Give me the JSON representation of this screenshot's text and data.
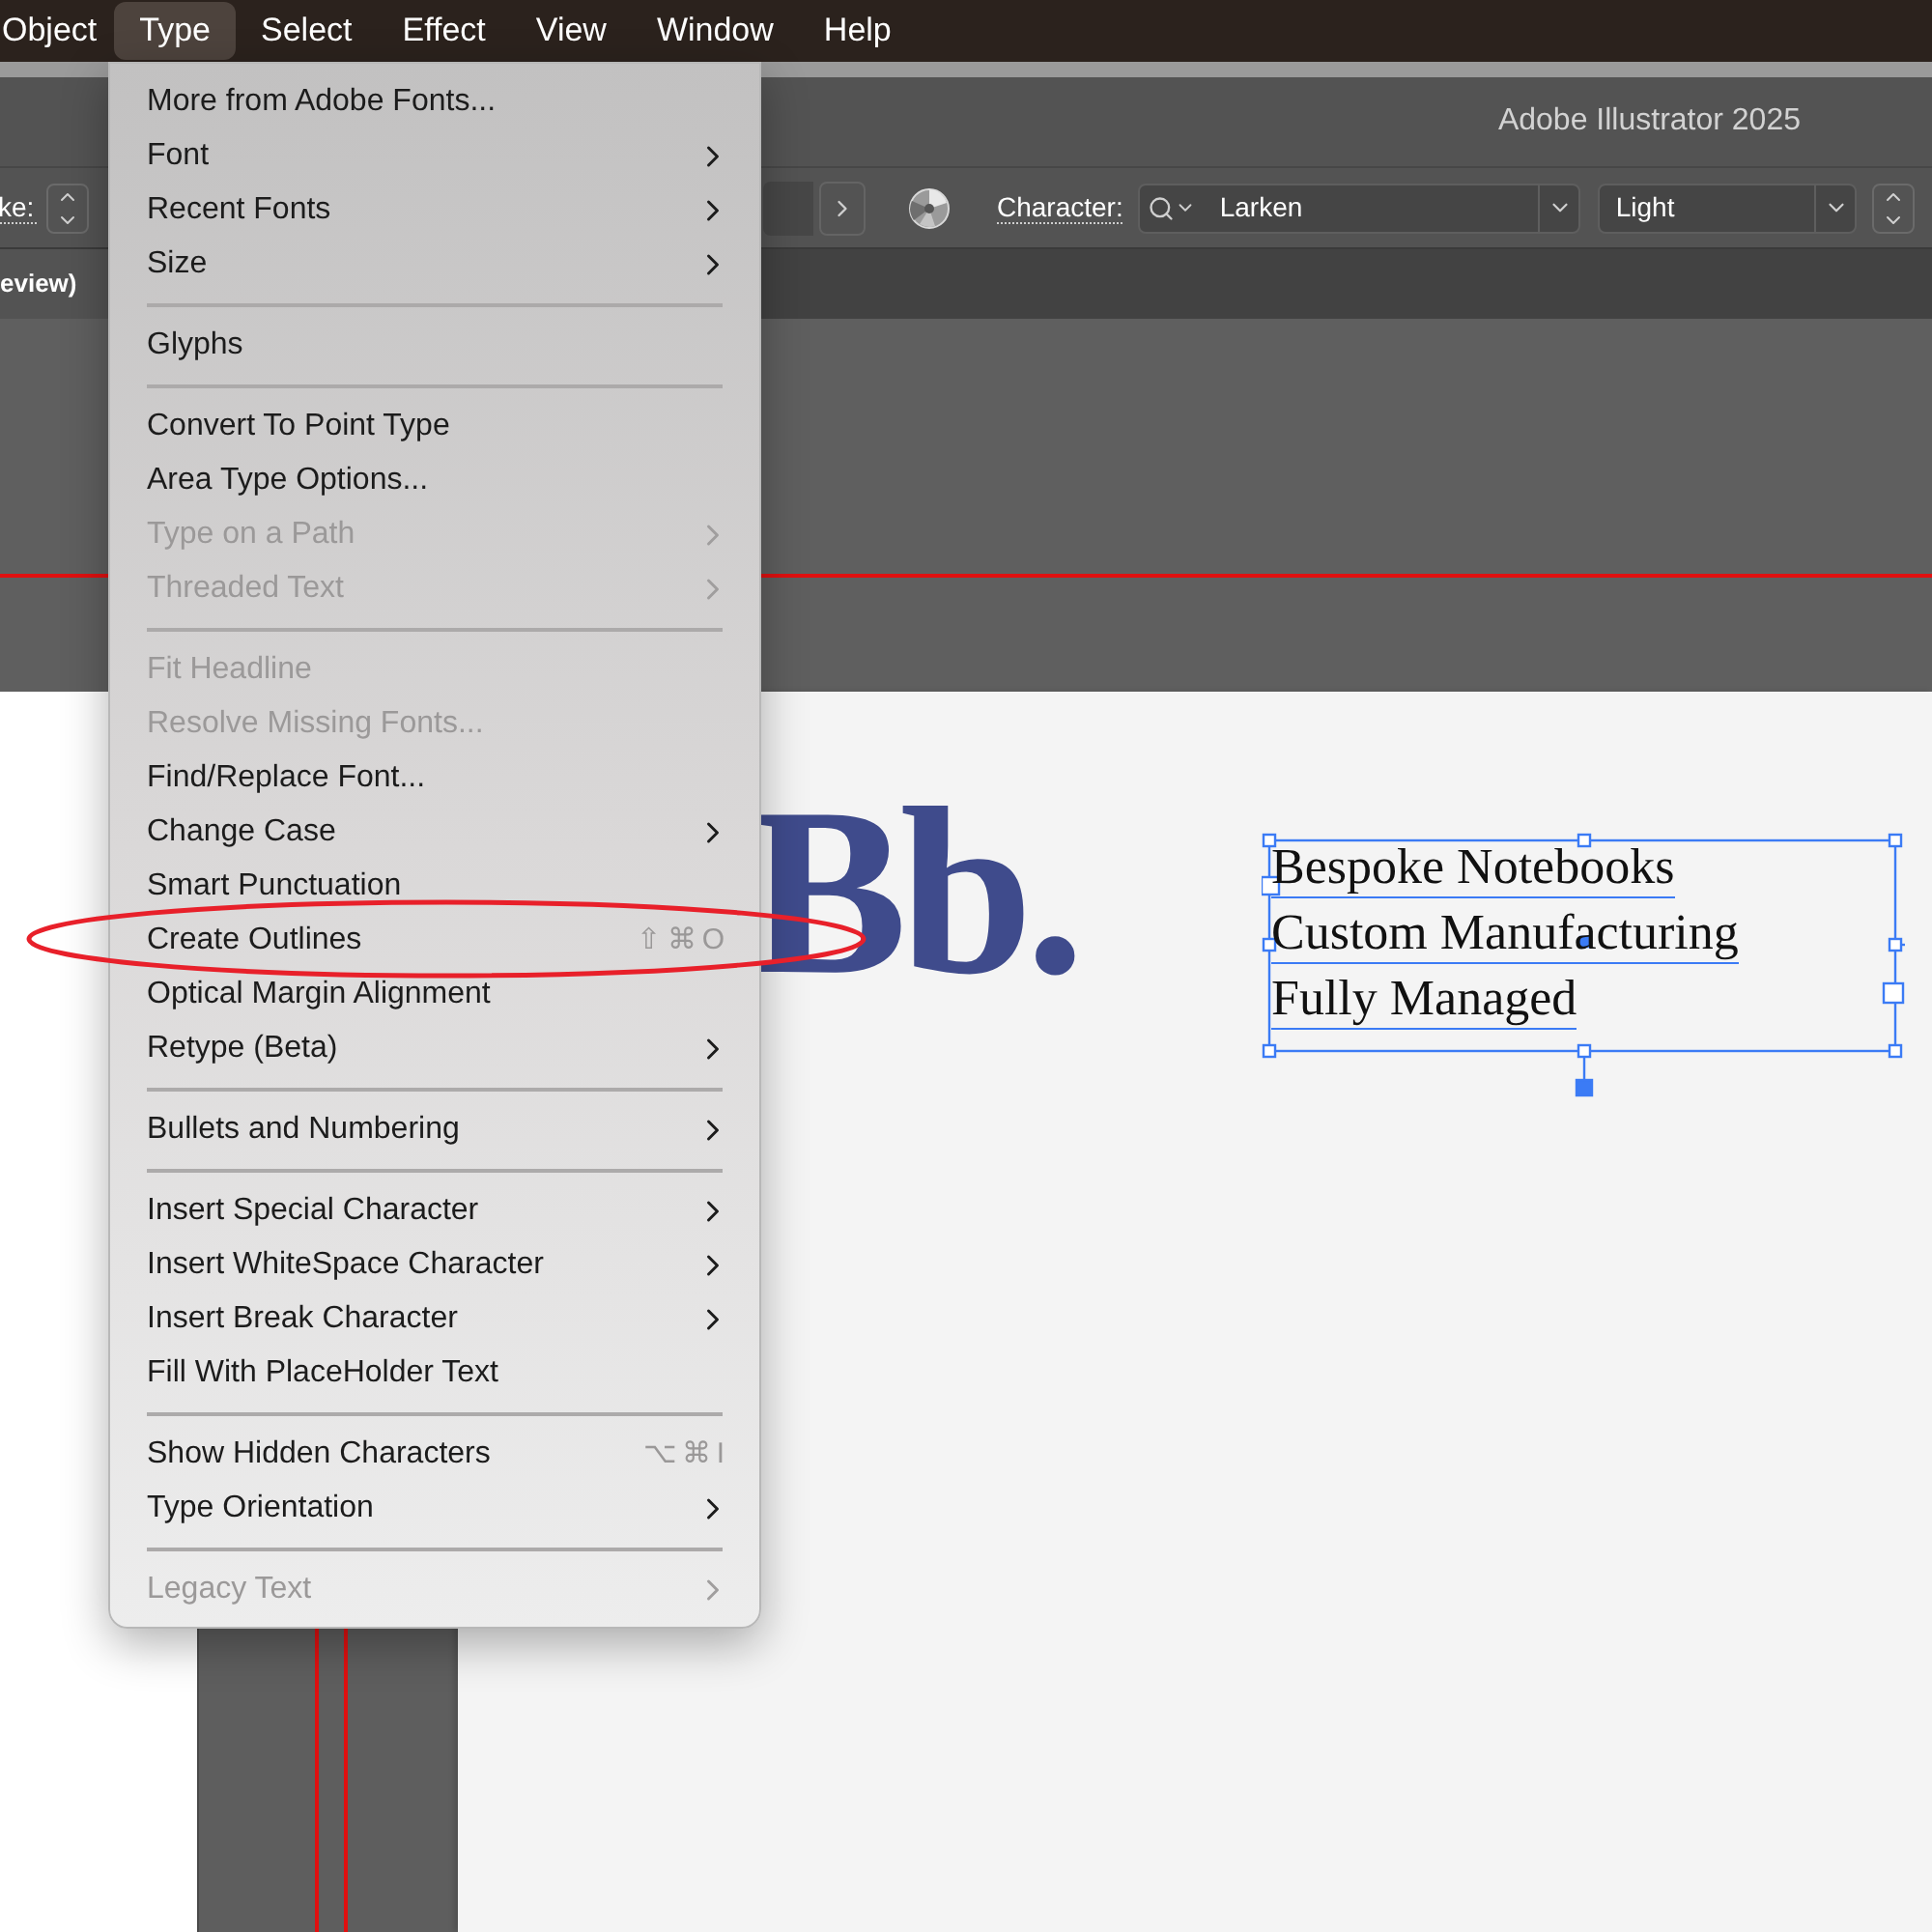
{
  "menu_bar": {
    "items": [
      {
        "label": "Object",
        "selected": false
      },
      {
        "label": "Type",
        "selected": true
      },
      {
        "label": "Select",
        "selected": false
      },
      {
        "label": "Effect",
        "selected": false
      },
      {
        "label": "View",
        "selected": false
      },
      {
        "label": "Window",
        "selected": false
      },
      {
        "label": "Help",
        "selected": false
      }
    ]
  },
  "window": {
    "title": "Adobe Illustrator 2025"
  },
  "control_bar": {
    "stroke_label": "ke:",
    "character_label": "Character:",
    "font_family": "Larken",
    "font_style": "Light"
  },
  "document_tab": {
    "label": "eview)"
  },
  "canvas": {
    "logo": "Bb.",
    "text_frame": {
      "selected": true,
      "lines": [
        "Bespoke Notebooks",
        "Custom Manufacturing",
        "Fully Managed"
      ]
    }
  },
  "type_menu": {
    "items": [
      {
        "kind": "item",
        "label": "More from Adobe Fonts...",
        "disabled": false,
        "submenu": false
      },
      {
        "kind": "item",
        "label": "Font",
        "disabled": false,
        "submenu": true
      },
      {
        "kind": "item",
        "label": "Recent Fonts",
        "disabled": false,
        "submenu": true
      },
      {
        "kind": "item",
        "label": "Size",
        "disabled": false,
        "submenu": true
      },
      {
        "kind": "separator"
      },
      {
        "kind": "item",
        "label": "Glyphs",
        "disabled": false,
        "submenu": false
      },
      {
        "kind": "separator"
      },
      {
        "kind": "item",
        "label": "Convert To Point Type",
        "disabled": false,
        "submenu": false
      },
      {
        "kind": "item",
        "label": "Area Type Options...",
        "disabled": false,
        "submenu": false
      },
      {
        "kind": "item",
        "label": "Type on a Path",
        "disabled": true,
        "submenu": true
      },
      {
        "kind": "item",
        "label": "Threaded Text",
        "disabled": true,
        "submenu": true
      },
      {
        "kind": "separator"
      },
      {
        "kind": "item",
        "label": "Fit Headline",
        "disabled": true,
        "submenu": false
      },
      {
        "kind": "item",
        "label": "Resolve Missing Fonts...",
        "disabled": true,
        "submenu": false
      },
      {
        "kind": "item",
        "label": "Find/Replace Font...",
        "disabled": false,
        "submenu": false
      },
      {
        "kind": "item",
        "label": "Change Case",
        "disabled": false,
        "submenu": true
      },
      {
        "kind": "item",
        "label": "Smart Punctuation",
        "disabled": false,
        "submenu": false
      },
      {
        "kind": "item",
        "label": "Create Outlines",
        "disabled": false,
        "submenu": false,
        "shortcut": "⇧⌘O"
      },
      {
        "kind": "item",
        "label": "Optical Margin Alignment",
        "disabled": false,
        "submenu": false
      },
      {
        "kind": "item",
        "label": "Retype (Beta)",
        "disabled": false,
        "submenu": true
      },
      {
        "kind": "separator"
      },
      {
        "kind": "item",
        "label": "Bullets and Numbering",
        "disabled": false,
        "submenu": true
      },
      {
        "kind": "separator"
      },
      {
        "kind": "item",
        "label": "Insert Special Character",
        "disabled": false,
        "submenu": true
      },
      {
        "kind": "item",
        "label": "Insert WhiteSpace Character",
        "disabled": false,
        "submenu": true
      },
      {
        "kind": "item",
        "label": "Insert Break Character",
        "disabled": false,
        "submenu": true
      },
      {
        "kind": "item",
        "label": "Fill With PlaceHolder Text",
        "disabled": false,
        "submenu": false
      },
      {
        "kind": "separator"
      },
      {
        "kind": "item",
        "label": "Show Hidden Characters",
        "disabled": false,
        "submenu": false,
        "shortcut": "⌥⌘I"
      },
      {
        "kind": "item",
        "label": "Type Orientation",
        "disabled": false,
        "submenu": true
      },
      {
        "kind": "separator"
      },
      {
        "kind": "item",
        "label": "Legacy Text",
        "disabled": true,
        "submenu": true
      }
    ]
  }
}
